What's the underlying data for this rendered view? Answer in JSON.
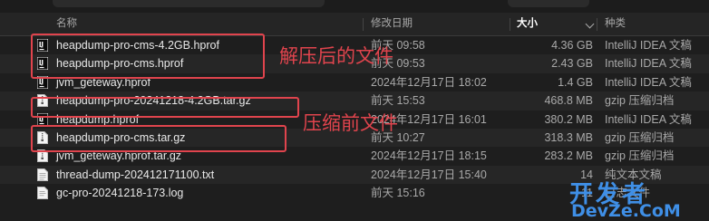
{
  "columns": {
    "name": "名称",
    "modified": "修改日期",
    "size": "大小",
    "kind": "种类"
  },
  "files": [
    {
      "name": "heapdump-pro-cms-4.2GB.hprof",
      "date": "前天 09:58",
      "size": "4.36 GB",
      "kind": "IntelliJ IDEA 文稿",
      "icon": "intellij-icon"
    },
    {
      "name": "heapdump-pro-cms.hprof",
      "date": "前天 09:53",
      "size": "2.43 GB",
      "kind": "IntelliJ IDEA 文稿",
      "icon": "intellij-icon"
    },
    {
      "name": "jvm_geteway.hprof",
      "date": "2024年12月17日 18:02",
      "size": "1.4 GB",
      "kind": "IntelliJ IDEA 文稿",
      "icon": "intellij-icon"
    },
    {
      "name": "heapdump-pro-20241218-4.2GB.tar.gz",
      "date": "前天 15:53",
      "size": "468.8 MB",
      "kind": "gzip 压缩归档",
      "icon": "archive-icon"
    },
    {
      "name": "heapdump.hprof",
      "date": "2024年12月17日 16:01",
      "size": "380.2 MB",
      "kind": "IntelliJ IDEA 文稿",
      "icon": "intellij-icon"
    },
    {
      "name": "heapdump-pro-cms.tar.gz",
      "date": "前天 10:27",
      "size": "318.3 MB",
      "kind": "gzip 压缩归档",
      "icon": "archive-icon"
    },
    {
      "name": "jvm_geteway.hprof.tar.gz",
      "date": "2024年12月17日 18:15",
      "size": "283.2 MB",
      "kind": "gzip 压缩归档",
      "icon": "archive-icon"
    },
    {
      "name": "thread-dump-202412171100.txt",
      "date": "2024年12月17日 15:40",
      "size": "14",
      "kind": "纯文本文稿",
      "icon": "text-file-icon"
    },
    {
      "name": "gc-pro-20241218-173.log",
      "date": "前天 15:16",
      "size": "11",
      "kind": "日志文件",
      "icon": "log-file-icon"
    }
  ],
  "annotations": {
    "decompressed": "解压后的文件",
    "compressed": "压缩前文件"
  },
  "watermark": {
    "line1": "开发者",
    "line2": "DevZe.CoM"
  },
  "colors": {
    "annotation": "#e0444d",
    "watermark": "#3f8fe6"
  }
}
